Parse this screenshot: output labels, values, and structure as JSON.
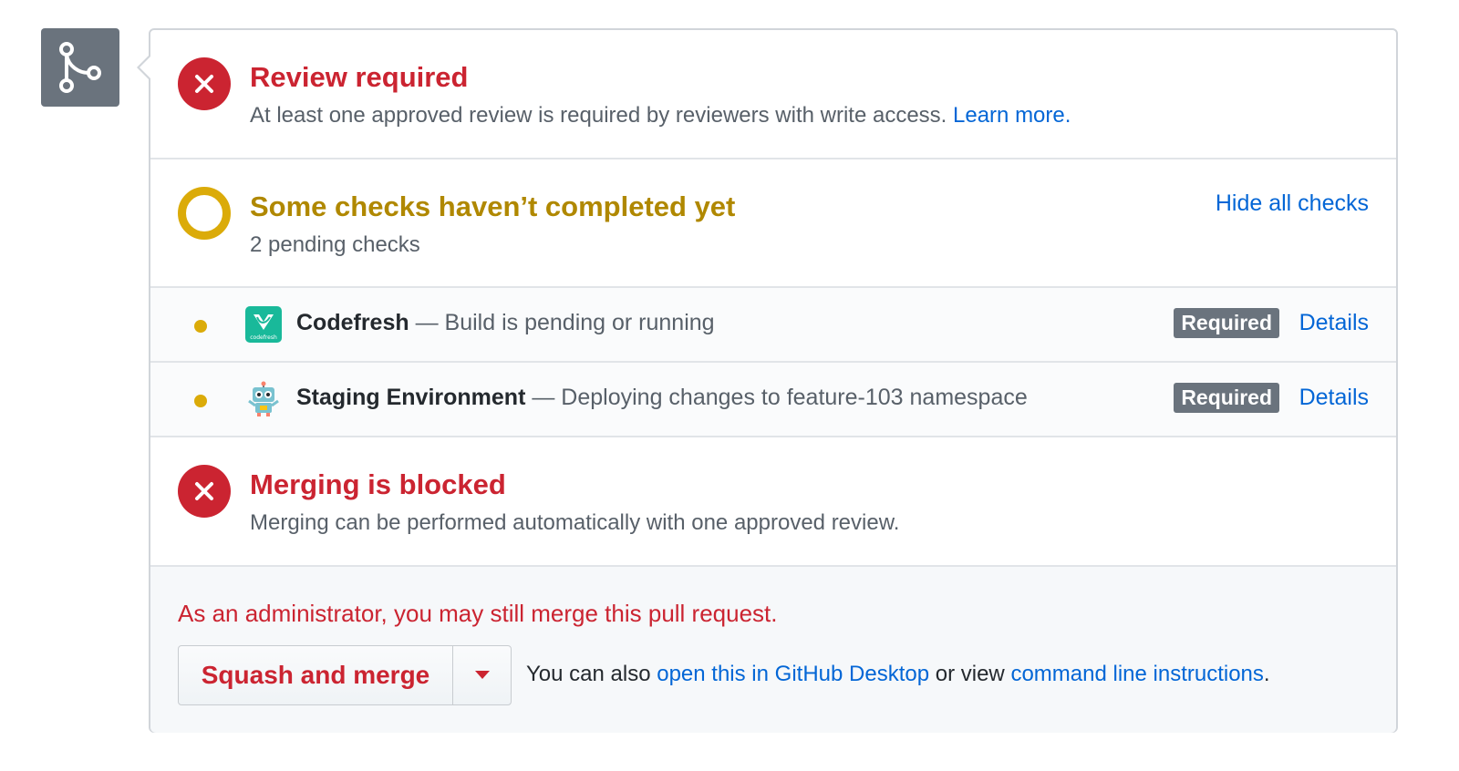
{
  "review": {
    "title": "Review required",
    "desc": "At least one approved review is required by reviewers with write access.",
    "learn_more": "Learn more."
  },
  "checks": {
    "title": "Some checks haven’t completed yet",
    "subtitle": "2 pending checks",
    "hide_all": "Hide all checks",
    "items": [
      {
        "name": "Codefresh",
        "status": "— Build is pending or running",
        "badge": "Required",
        "details": "Details",
        "avatar_icon": "codefresh-logo-icon",
        "avatar_text": "codefresh"
      },
      {
        "name": "Staging Environment",
        "status": "— Deploying changes to feature-103 namespace",
        "badge": "Required",
        "details": "Details",
        "avatar_icon": "robot-icon"
      }
    ]
  },
  "blocked": {
    "title": "Merging is blocked",
    "desc": "Merging can be performed automatically with one approved review."
  },
  "admin": {
    "notice": "As an administrator, you may still merge this pull request.",
    "merge_button": "Squash and merge",
    "also_prefix": "You can also",
    "desktop_link": "open this in GitHub Desktop",
    "or_view": "or view",
    "cli_link": "command line instructions",
    "period": "."
  },
  "colors": {
    "error": "#cb2431",
    "pending": "#dbab09",
    "link": "#0366d6",
    "badge": "#6a737d"
  }
}
